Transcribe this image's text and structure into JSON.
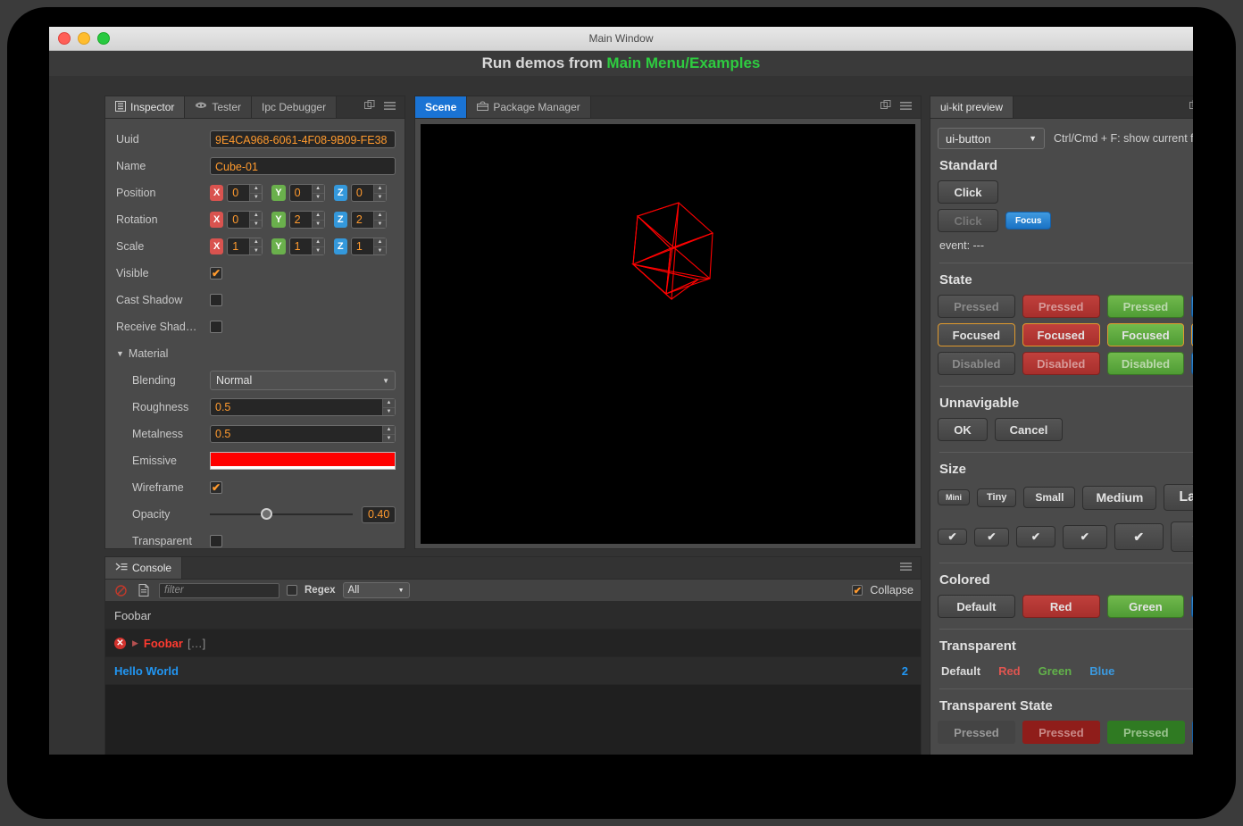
{
  "window": {
    "title": "Main Window",
    "banner_prefix": "Run demos from ",
    "banner_accent": "Main Menu/Examples",
    "accent_color": "#2ecc40"
  },
  "inspector": {
    "tabs": [
      {
        "label": "Inspector",
        "icon": "inspector-icon",
        "active": true
      },
      {
        "label": "Tester",
        "icon": "tester-face-icon",
        "active": false
      },
      {
        "label": "Ipc Debugger",
        "icon": "",
        "active": false
      }
    ],
    "fields": {
      "uuid_label": "Uuid",
      "uuid_value": "9E4CA968-6061-4F08-9B09-FE38",
      "name_label": "Name",
      "name_value": "Cube-01",
      "position_label": "Position",
      "position": {
        "x": "0",
        "y": "0",
        "z": "0"
      },
      "rotation_label": "Rotation",
      "rotation": {
        "x": "0",
        "y": "2",
        "z": "2"
      },
      "scale_label": "Scale",
      "scale": {
        "x": "1",
        "y": "1",
        "z": "1"
      },
      "visible_label": "Visible",
      "visible_checked": "✔",
      "cast_shadow_label": "Cast Shadow",
      "receive_shadow_label": "Receive Shad…",
      "material_label": "Material",
      "material_expanded": "▼",
      "blending_label": "Blending",
      "blending_value": "Normal",
      "roughness_label": "Roughness",
      "roughness_value": "0.5",
      "metalness_label": "Metalness",
      "metalness_value": "0.5",
      "emissive_label": "Emissive",
      "emissive_color": "#ff0000",
      "wireframe_label": "Wireframe",
      "wireframe_checked": "✔",
      "opacity_label": "Opacity",
      "opacity_value": "0.40",
      "transparent_label": "Transparent"
    },
    "axis_labels": {
      "x": "X",
      "y": "Y",
      "z": "Z"
    }
  },
  "scene": {
    "tabs": [
      {
        "label": "Scene",
        "active": true
      },
      {
        "label": "Package Manager",
        "icon": "package-icon",
        "active": false
      }
    ],
    "viewport_bg": "#000000",
    "wireframe_color": "#ff0000"
  },
  "console": {
    "tab_label": "Console",
    "tab_icon": "console-prompt-icon",
    "toolbar": {
      "clear_icon": "clear-icon",
      "file_icon": "file-icon",
      "filter_placeholder": "filter",
      "regex_label": "Regex",
      "level_value": "All",
      "collapse_label": "Collapse",
      "collapse_checked": "✔"
    },
    "rows": [
      {
        "type": "plain",
        "text": "Foobar",
        "count": ""
      },
      {
        "type": "error",
        "text": "Foobar",
        "suffix": "[…]",
        "count": ""
      },
      {
        "type": "info",
        "text": "Hello World",
        "count": "2"
      }
    ]
  },
  "uikit": {
    "tab_label": "ui-kit preview",
    "component_select": "ui-button",
    "hint": "Ctrl/Cmd + F: show current focus",
    "sections": {
      "standard": {
        "title": "Standard",
        "click_label": "Click",
        "click_disabled_label": "Click",
        "focus_label": "Focus",
        "event_text": "event: ---"
      },
      "state": {
        "title": "State",
        "rows": [
          {
            "label": "Pressed",
            "variants": [
              "Pressed",
              "Pressed",
              "Pressed",
              ""
            ]
          },
          {
            "label": "Focused",
            "variants": [
              "Focused",
              "Focused",
              "Focused",
              ""
            ]
          },
          {
            "label": "Disabled",
            "variants": [
              "Disabled",
              "Disabled",
              "Disabled",
              ""
            ]
          }
        ]
      },
      "unnavigable": {
        "title": "Unnavigable",
        "ok_label": "OK",
        "cancel_label": "Cancel"
      },
      "size": {
        "title": "Size",
        "labels": [
          "Mini",
          "Tiny",
          "Small",
          "Medium",
          "Large"
        ],
        "check_glyph": "✔"
      },
      "colored": {
        "title": "Colored",
        "labels": [
          "Default",
          "Red",
          "Green",
          ""
        ]
      },
      "transparent": {
        "title": "Transparent",
        "labels": [
          "Default",
          "Red",
          "Green",
          "Blue"
        ]
      },
      "transparent_state": {
        "title": "Transparent State",
        "labels": [
          "Pressed",
          "Pressed",
          "Pressed",
          ""
        ]
      }
    }
  }
}
